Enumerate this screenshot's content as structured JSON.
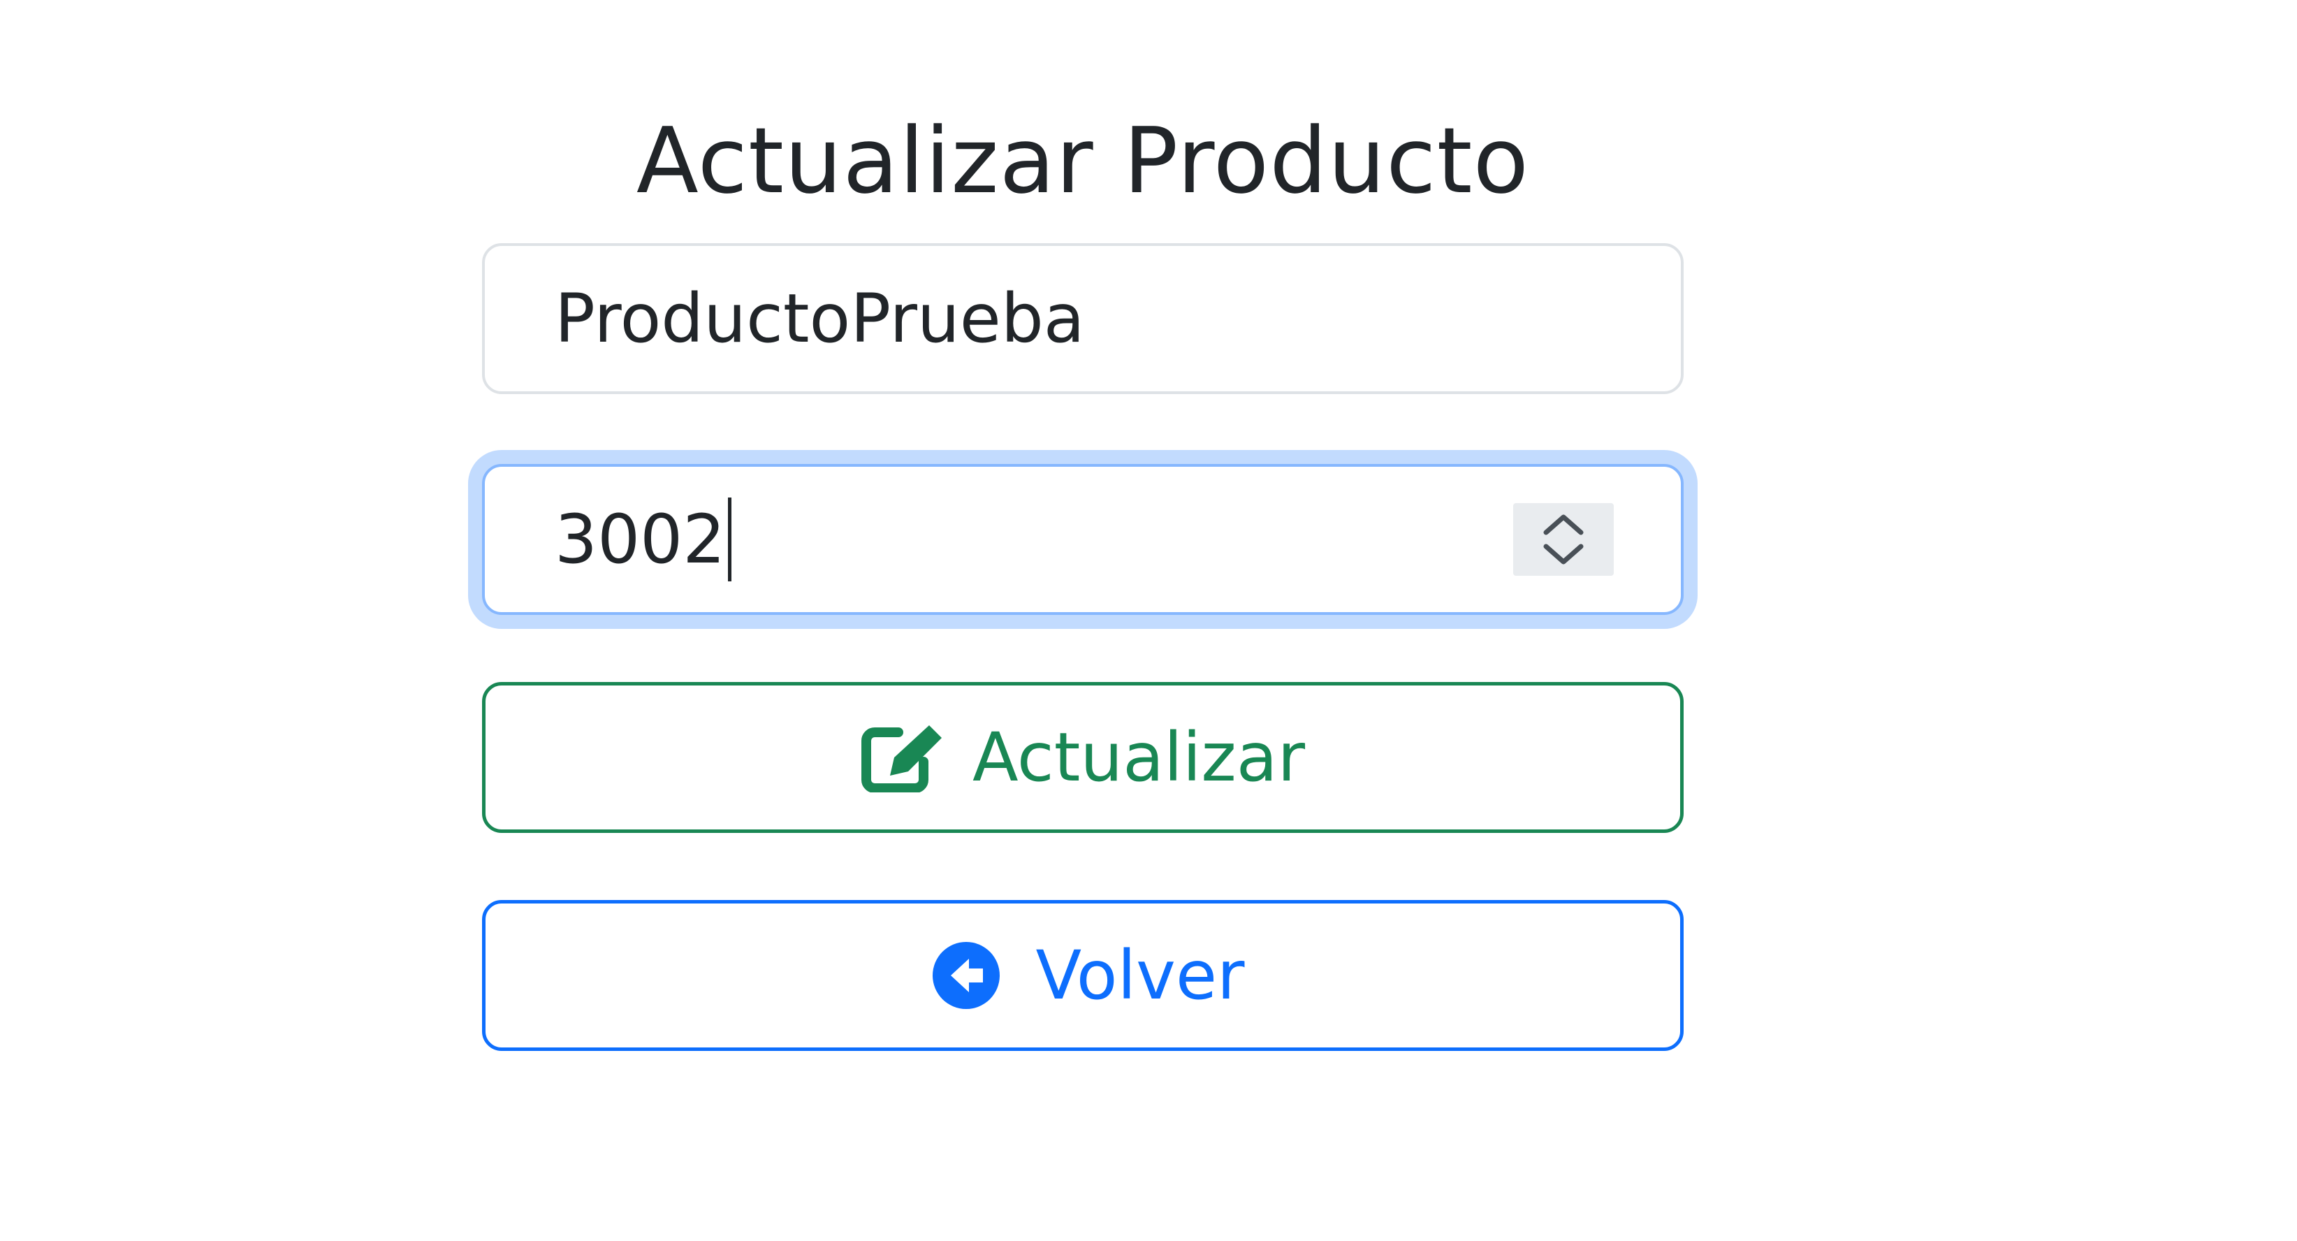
{
  "page": {
    "title": "Actualizar Producto"
  },
  "form": {
    "name_value": "ProductoPrueba",
    "quantity_value": "3002",
    "update_label": "Actualizar",
    "update_icon": "edit-icon",
    "back_label": "Volver",
    "back_icon": "arrow-circle-left-icon"
  },
  "colors": {
    "update": "#198754",
    "back": "#0d6efd",
    "focus_ring": "#86b7fe"
  }
}
